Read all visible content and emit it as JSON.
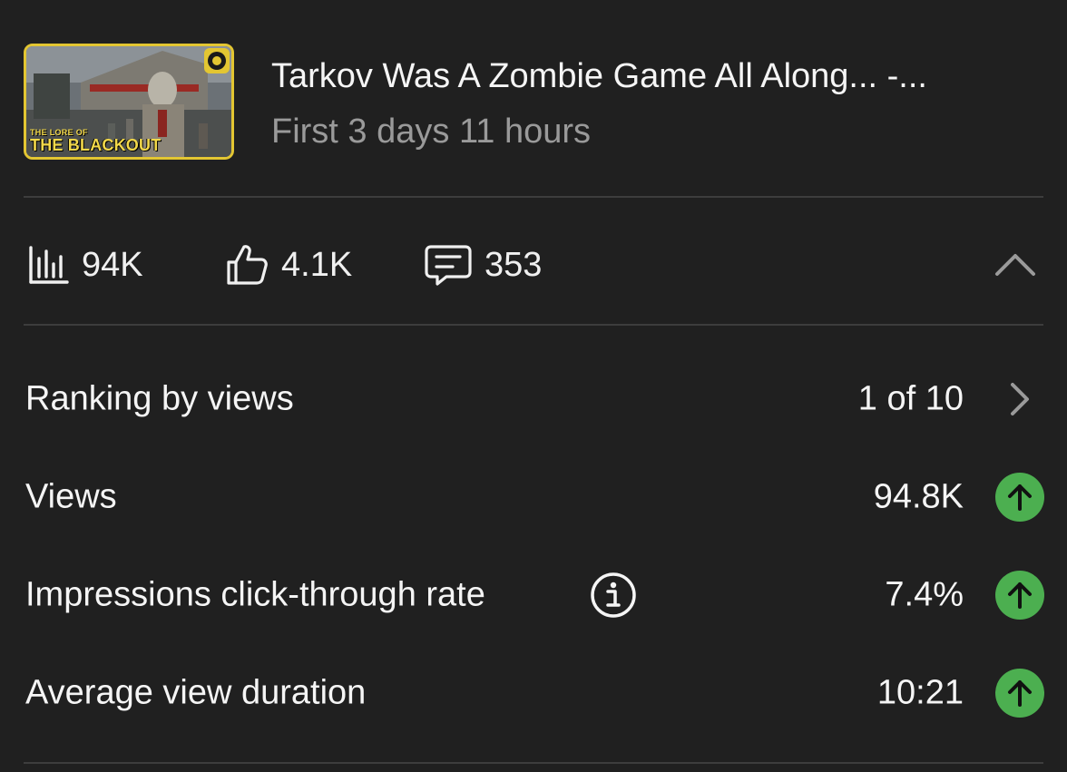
{
  "video": {
    "title": "Tarkov Was A Zombie Game All Along... -...",
    "period": "First 3 days 11 hours",
    "thumbnail": {
      "caption_small": "THE LORE OF",
      "caption_big": "THE BLACKOUT",
      "border_color": "#e3c632"
    }
  },
  "stats": {
    "views": {
      "icon": "bar-chart-icon",
      "value": "94K"
    },
    "likes": {
      "icon": "thumbs-up-icon",
      "value": "4.1K"
    },
    "comments": {
      "icon": "comment-icon",
      "value": "353"
    },
    "collapse_icon": "chevron-up-icon"
  },
  "metrics": [
    {
      "label": "Ranking by views",
      "value": "1 of 10",
      "trail": "chevron-right-icon"
    },
    {
      "label": "Views",
      "value": "94.8K",
      "trail": "arrow-up-circle-icon"
    },
    {
      "label": "Impressions click-through rate",
      "value": "7.4%",
      "trail": "arrow-up-circle-icon",
      "has_info": true
    },
    {
      "label": "Average view duration",
      "value": "10:21",
      "trail": "arrow-up-circle-icon"
    }
  ],
  "colors": {
    "background": "#202020",
    "divider": "#3d3d3d",
    "secondary_text": "#9a9a9a",
    "up_green": "#4caf50"
  }
}
